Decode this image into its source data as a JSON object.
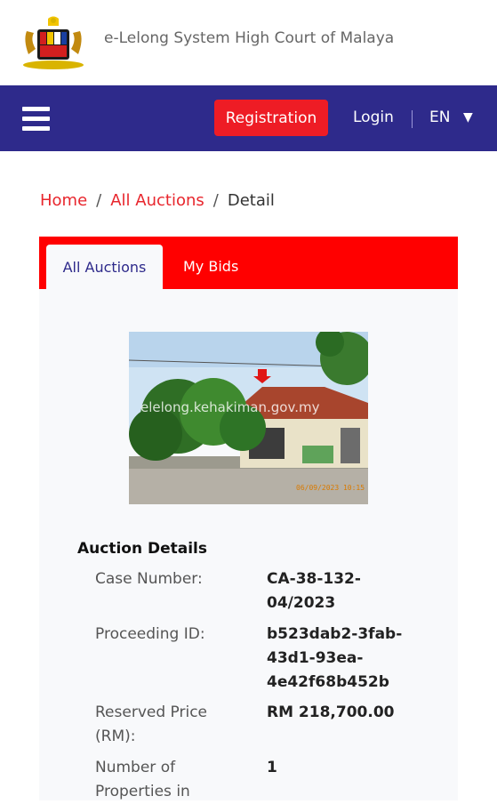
{
  "header": {
    "site_title": "e-Lelong System High Court of Malaya"
  },
  "nav": {
    "registration_label": "Registration",
    "login_label": "Login",
    "language": "EN",
    "caret": "▼",
    "accent_color": "#2e2a8b",
    "button_color": "#ee1c25"
  },
  "breadcrumb": {
    "items": [
      "Home",
      "All Auctions",
      "Detail"
    ],
    "separator": "/"
  },
  "tabs": [
    {
      "label": "All Auctions",
      "active": true
    },
    {
      "label": "My Bids",
      "active": false
    }
  ],
  "photo": {
    "watermark": "elelong.kehakiman.gov.my",
    "stamp": "06/09/2023 10:15"
  },
  "details": {
    "title": "Auction Details",
    "rows": [
      {
        "label_lines": [
          "Case Number:"
        ],
        "value_lines": [
          "CA-38-132-",
          "04/2023"
        ]
      },
      {
        "label_lines": [
          "Proceeding ID:"
        ],
        "value_lines": [
          "b523dab2-3fab-",
          "43d1-93ea-",
          "4e42f68b452b"
        ]
      },
      {
        "label_lines": [
          "Reserved Price",
          "(RM):"
        ],
        "value_lines": [
          "RM 218,700.00"
        ]
      },
      {
        "label_lines": [
          "Number of",
          "Properties in"
        ],
        "value_lines": [
          "1"
        ]
      }
    ]
  }
}
